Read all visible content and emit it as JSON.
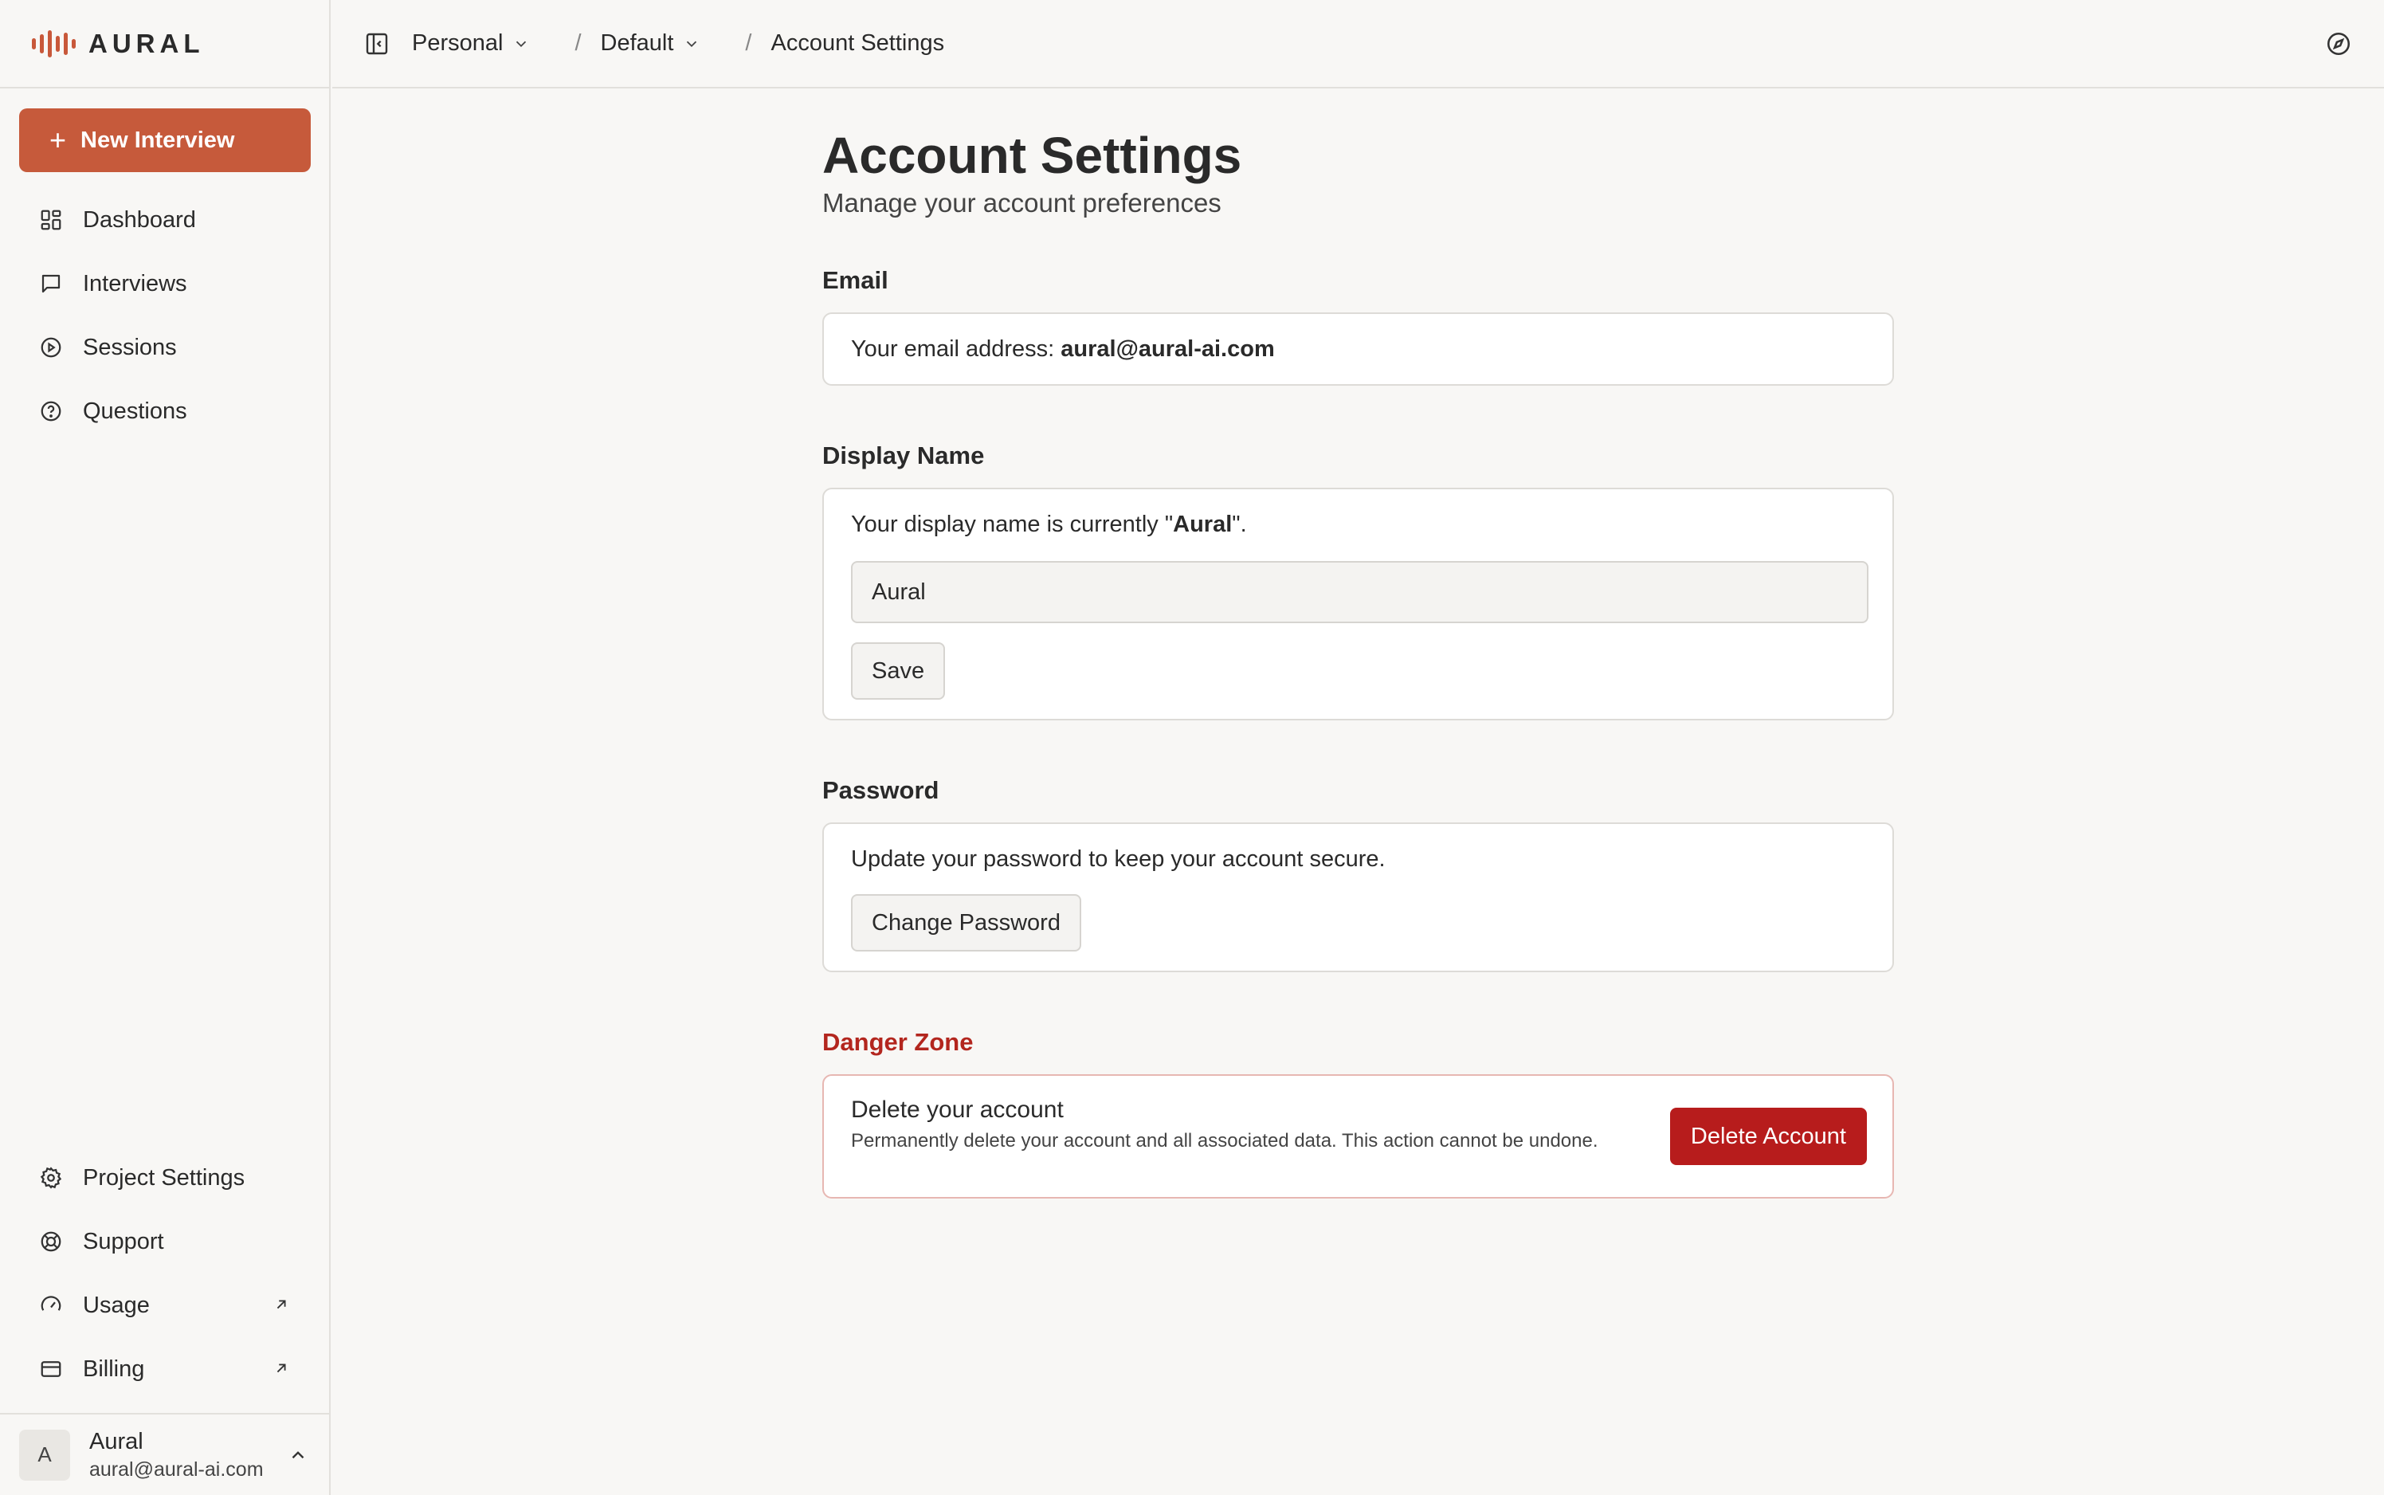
{
  "brand": {
    "name": "AURAL",
    "accent": "#c65a3b"
  },
  "sidebar": {
    "new_button": "New Interview",
    "nav": [
      {
        "label": "Dashboard",
        "icon": "dashboard-icon"
      },
      {
        "label": "Interviews",
        "icon": "chat-icon"
      },
      {
        "label": "Sessions",
        "icon": "play-circle-icon"
      },
      {
        "label": "Questions",
        "icon": "help-circle-icon"
      }
    ],
    "bottom_nav": [
      {
        "label": "Project Settings",
        "icon": "gear-icon"
      },
      {
        "label": "Support",
        "icon": "lifebuoy-icon"
      },
      {
        "label": "Usage",
        "icon": "gauge-icon",
        "external": true
      },
      {
        "label": "Billing",
        "icon": "credit-card-icon",
        "external": true
      }
    ],
    "user": {
      "initial": "A",
      "name": "Aural",
      "email": "aural@aural-ai.com"
    }
  },
  "header": {
    "breadcrumb": [
      {
        "label": "Personal",
        "dropdown": true
      },
      {
        "label": "Default",
        "dropdown": true
      }
    ],
    "current": "Account Settings"
  },
  "page": {
    "title": "Account Settings",
    "subtitle": "Manage your account preferences"
  },
  "email_section": {
    "title": "Email",
    "prefix": "Your email address: ",
    "value": "aural@aural-ai.com"
  },
  "display_name_section": {
    "title": "Display Name",
    "text_prefix": "Your display name is currently \"",
    "current_name": "Aural",
    "text_suffix": "\".",
    "input_value": "Aural",
    "save_label": "Save"
  },
  "password_section": {
    "title": "Password",
    "description": "Update your password to keep your account secure.",
    "button_label": "Change Password"
  },
  "danger_section": {
    "title": "Danger Zone",
    "heading": "Delete your account",
    "description": "Permanently delete your account and all associated data. This action cannot be undone.",
    "button_label": "Delete Account",
    "color": "#b71c1c"
  }
}
